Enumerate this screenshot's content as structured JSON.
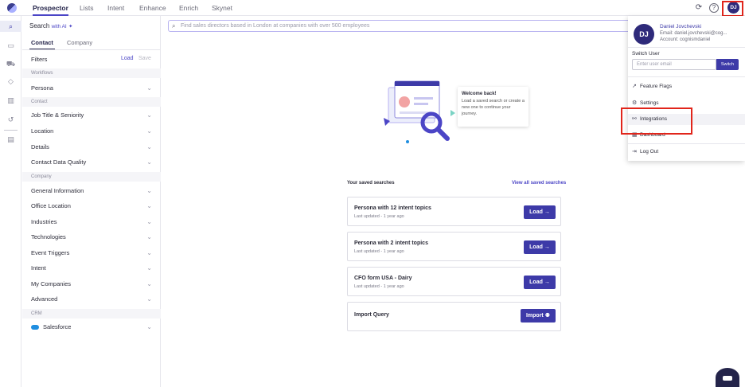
{
  "nav": {
    "tabs": [
      "Prospector",
      "Lists",
      "Intent",
      "Enhance",
      "Enrich",
      "Skynet"
    ],
    "active_tab": "Prospector",
    "avatar_initials": "DJ"
  },
  "filters": {
    "search_label": "Search",
    "search_ai": "with AI",
    "tabs": [
      "Contact",
      "Company"
    ],
    "title": "Filters",
    "load": "Load",
    "save": "Save",
    "sections": {
      "workflows": "Workflows",
      "contact": "Contact",
      "company": "Company",
      "crm": "CRM"
    },
    "workflows_items": [
      "Persona"
    ],
    "contact_items": [
      "Job Title & Seniority",
      "Location",
      "Details",
      "Contact Data Quality"
    ],
    "company_items": [
      "General Information",
      "Office Location",
      "Industries",
      "Technologies",
      "Event Triggers",
      "Intent",
      "My Companies",
      "Advanced"
    ],
    "crm_items": [
      "Salesforce"
    ]
  },
  "main": {
    "search_placeholder": "Find sales directors based in London at companies with over 500 employees",
    "welcome_title": "Welcome back!",
    "welcome_body": "Load a saved search or create a new one to continue your journey.",
    "saved_title": "Your saved searches",
    "view_all": "View all saved searches",
    "saved": [
      {
        "name": "Persona with 12 intent topics",
        "updated": "Last updated - 1 year ago",
        "action": "Load"
      },
      {
        "name": "Persona with 2 intent topics",
        "updated": "Last updated - 1 year ago",
        "action": "Load"
      },
      {
        "name": "CFO form USA - Dairy",
        "updated": "Last updated - 1 year ago",
        "action": "Load"
      }
    ],
    "import_title": "Import Query",
    "import_action": "Import"
  },
  "user_menu": {
    "initials": "DJ",
    "name": "Daniel Jovchevski",
    "email": "Email: daniel.jovchevski@cog...",
    "account": "Account: cognismdaniel",
    "switch_label": "Switch User",
    "switch_placeholder": "Enter user email",
    "switch_button": "Switch",
    "items": [
      "Feature Flags",
      "Settings",
      "Integrations",
      "Dashboard",
      "Log Out"
    ]
  },
  "colors": {
    "accent": "#3d3aa8",
    "highlight": "#e1251b"
  }
}
